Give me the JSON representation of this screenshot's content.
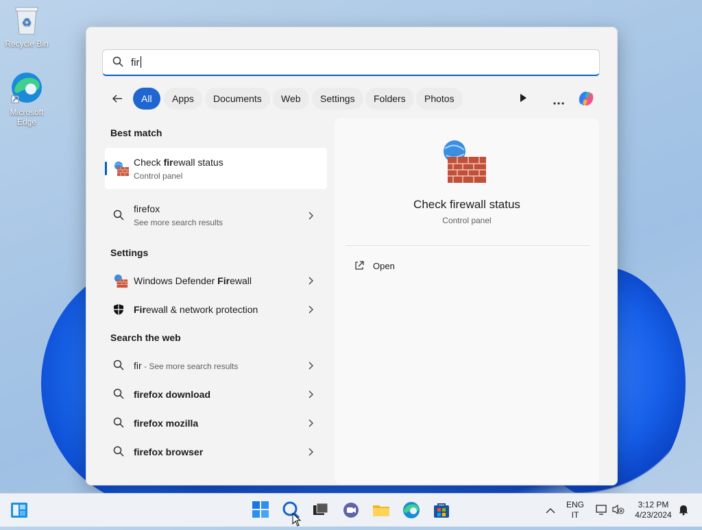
{
  "desktop": {
    "icons": [
      {
        "label": "Recycle Bin"
      },
      {
        "label": "Microsoft Edge"
      }
    ]
  },
  "search": {
    "query": "fir"
  },
  "filters": [
    "All",
    "Apps",
    "Documents",
    "Web",
    "Settings",
    "Folders",
    "Photos"
  ],
  "best_match": {
    "heading": "Best match",
    "title_pre": "Check ",
    "title_bold": "fir",
    "title_post": "ewall status",
    "subtitle": "Control panel"
  },
  "suggestion": {
    "title": "firefox",
    "subtitle": "See more search results"
  },
  "settings": {
    "heading": "Settings",
    "items": [
      {
        "pre": "Windows Defender ",
        "bold": "Fir",
        "post": "ewall"
      },
      {
        "pre": "",
        "bold": "Fir",
        "post": "ewall & network protection"
      }
    ]
  },
  "web": {
    "heading": "Search the web",
    "items": [
      {
        "bold": "fir",
        "rest": " - See more search results"
      },
      {
        "bold": "firefox download",
        "rest": ""
      },
      {
        "bold": "firefox mozilla",
        "rest": ""
      },
      {
        "bold": "firefox browser",
        "rest": ""
      }
    ]
  },
  "detail": {
    "title": "Check firewall status",
    "subtitle": "Control panel",
    "action": "Open"
  },
  "tray": {
    "lang1": "ENG",
    "lang2": "IT",
    "time": "3:12 PM",
    "date": "4/23/2024"
  },
  "colors": {
    "accent": "#005fb8",
    "chip_active": "#1f66d1"
  }
}
